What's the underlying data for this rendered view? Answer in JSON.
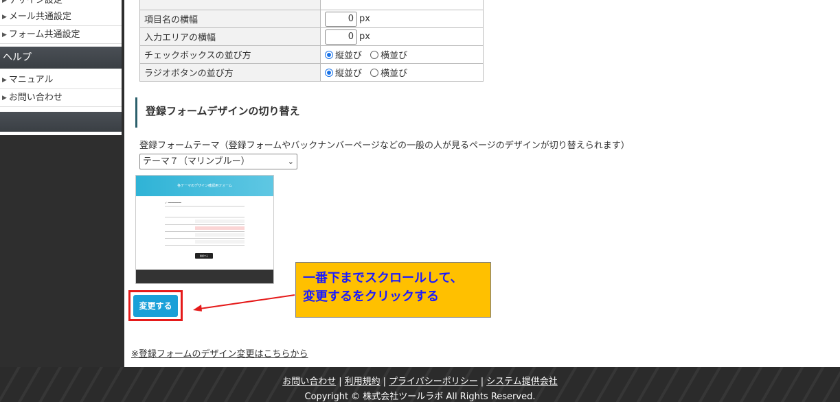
{
  "sidebar": {
    "items_top": [
      {
        "label": "デザイン設定"
      },
      {
        "label": "メール共通設定"
      },
      {
        "label": "フォーム共通設定"
      }
    ],
    "help_heading": "ヘルプ",
    "items_help": [
      {
        "label": "マニュアル"
      },
      {
        "label": "お問い合わせ"
      }
    ]
  },
  "settings": {
    "rows": [
      {
        "label": "項目名の横幅",
        "value": "0",
        "unit": "px"
      },
      {
        "label": "入力エリアの横幅",
        "value": "0",
        "unit": "px"
      },
      {
        "label": "チェックボックスの並び方",
        "option1": "縦並び",
        "option2": "横並び",
        "selected": "縦並び"
      },
      {
        "label": "ラジオボタンの並び方",
        "option1": "縦並び",
        "option2": "横並び",
        "selected": "縦並び"
      }
    ]
  },
  "section": {
    "title": "登録フォームデザインの切り替え",
    "theme_label": "登録フォームテーマ（登録フォームやバックナンバーページなどの一般の人が見るページのデザインが切り替えられます）",
    "theme_selected": "テーマ７（マリンブルー）"
  },
  "preview": {
    "header": "各テーマのデザイン確認用フォーム",
    "submit": "確認する"
  },
  "actions": {
    "change_button": "変更する"
  },
  "callout": {
    "line1": "一番下までスクロールして、",
    "line2": "変更するをクリックする"
  },
  "links": {
    "design_change": "※登録フォームのデザイン変更はこちらから"
  },
  "footer": {
    "links": [
      "お問い合わせ",
      "利用規約",
      "プライバシーポリシー",
      "システム提供会社"
    ],
    "separator": "|",
    "copyright": "Copyright © 株式会社ツールラボ All Rights Reserved."
  },
  "colors": {
    "accent_button": "#1aa0d8",
    "highlight_border": "#e51a1a",
    "callout_bg": "#ffc000",
    "callout_text": "#1a1aff"
  }
}
